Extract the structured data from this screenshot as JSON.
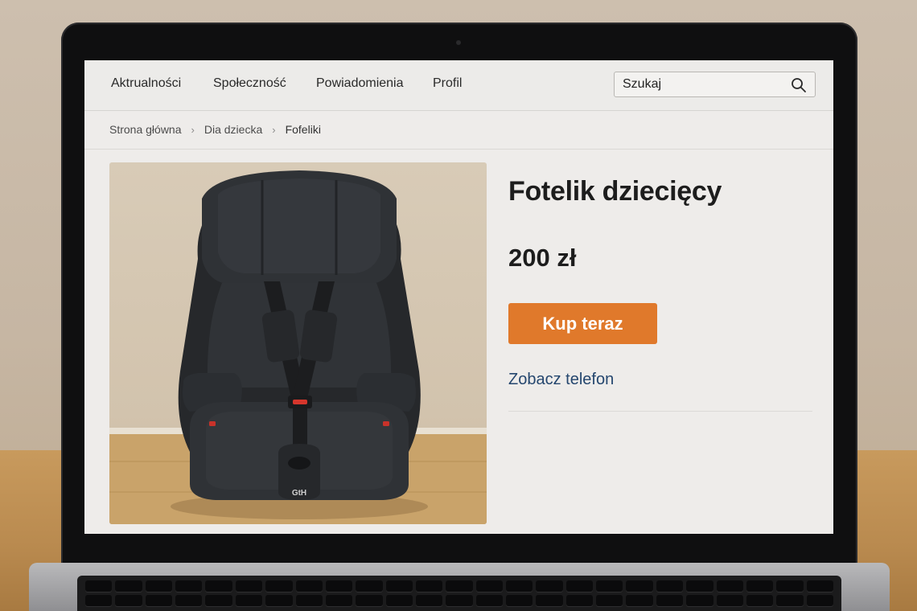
{
  "nav": {
    "items": [
      {
        "label": "Aktrualności",
        "name": "nav-item-aktualnosci"
      },
      {
        "label": "Społeczność",
        "name": "nav-item-spolecznosc"
      },
      {
        "label": "Powiadomienia",
        "name": "nav-item-powiadomienia"
      },
      {
        "label": "Profil",
        "name": "nav-item-profil"
      }
    ]
  },
  "search": {
    "placeholder": "Szukaj",
    "icon": "search-icon"
  },
  "breadcrumb": {
    "items": [
      "Strona główna",
      "Dia dziecka",
      "Fofeliki"
    ],
    "separator": "›"
  },
  "product": {
    "title": "Fotelik dziecięcy",
    "price": "200 zł",
    "buy_label": "Kup teraz",
    "phone_label": "Zobacz telefon",
    "seat_logo": "GtH"
  },
  "colors": {
    "accent": "#e0792b",
    "link": "#24466e",
    "seat": "#2b2d30"
  }
}
